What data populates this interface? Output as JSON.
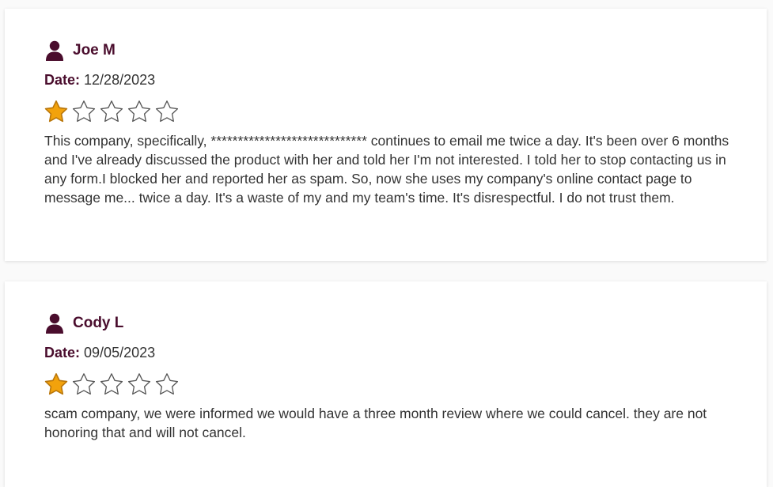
{
  "colors": {
    "accent": "#4a0d2d",
    "star_filled": "#f2a20c",
    "star_filled_outline": "#b9760a",
    "star_empty_outline": "#555555",
    "text": "#333333"
  },
  "reviews": [
    {
      "author": "Joe M",
      "date_label": "Date:",
      "date": "12/28/2023",
      "rating": 1,
      "max_rating": 5,
      "text": "This company, specifically, ***************************** continues to email me twice a day. It's been over 6 months and I've already discussed the product with her and told her I'm not interested. I told her to stop contacting us in any form.I blocked her and reported her as spam. So, now she uses my company's online contact page to message me... twice a day. It's a waste of my and my team's time. It's disrespectful. I do not trust them.",
      "icon": "user-icon"
    },
    {
      "author": "Cody L",
      "date_label": "Date:",
      "date": "09/05/2023",
      "rating": 1,
      "max_rating": 5,
      "text": "scam company, we were informed we would have a three month review where we could cancel. they are not honoring that and will not cancel.",
      "icon": "user-icon"
    }
  ]
}
